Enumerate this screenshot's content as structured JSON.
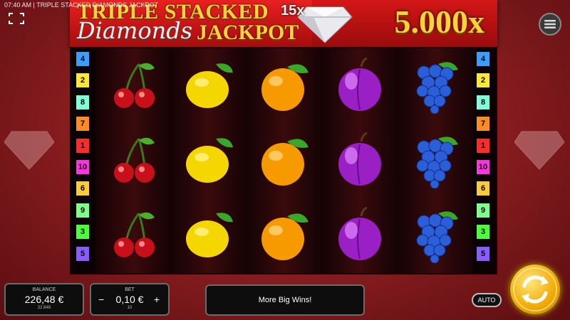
{
  "status_bar": {
    "time": "07:40 AM",
    "separator": "|",
    "game_title": "TRIPLE STACKED DIAMONDS JACKPOT"
  },
  "banner": {
    "line1": "TRIPLE STACKED",
    "line2": "Diamonds",
    "line3": "JACKPOT",
    "multiplier": "15x",
    "jackpot_value": "5.000x"
  },
  "paylines_left": [
    {
      "num": "4",
      "color": "#3d9cff"
    },
    {
      "num": "2",
      "color": "#ffe833"
    },
    {
      "num": "8",
      "color": "#7fffd9"
    },
    {
      "num": "7",
      "color": "#ff8c22"
    },
    {
      "num": "1",
      "color": "#ff2a2a"
    },
    {
      "num": "10",
      "color": "#ff33e0"
    },
    {
      "num": "6",
      "color": "#ffcc33"
    },
    {
      "num": "9",
      "color": "#7dff8a"
    },
    {
      "num": "3",
      "color": "#4cff3a"
    },
    {
      "num": "5",
      "color": "#8a5cff"
    }
  ],
  "paylines_right": [
    {
      "num": "4",
      "color": "#3d9cff"
    },
    {
      "num": "2",
      "color": "#ffe833"
    },
    {
      "num": "8",
      "color": "#7fffd9"
    },
    {
      "num": "7",
      "color": "#ff8c22"
    },
    {
      "num": "1",
      "color": "#ff2a2a"
    },
    {
      "num": "10",
      "color": "#ff33e0"
    },
    {
      "num": "6",
      "color": "#ffcc33"
    },
    {
      "num": "9",
      "color": "#7dff8a"
    },
    {
      "num": "3",
      "color": "#4cff3a"
    },
    {
      "num": "5",
      "color": "#8a5cff"
    }
  ],
  "reels": [
    [
      "cherry",
      "cherry",
      "cherry"
    ],
    [
      "lemon",
      "lemon",
      "lemon"
    ],
    [
      "orange",
      "orange",
      "orange"
    ],
    [
      "plum",
      "plum",
      "plum"
    ],
    [
      "grapes",
      "grapes",
      "grapes"
    ]
  ],
  "controls": {
    "balance_label": "BALANCE",
    "balance_value": "226,48 €",
    "balance_sub": "22.648",
    "bet_label": "BET",
    "bet_value": "0,10 €",
    "bet_sub": "10",
    "bet_minus": "−",
    "bet_plus": "+",
    "message": "More Big Wins!",
    "auto_label": "AUTO"
  }
}
